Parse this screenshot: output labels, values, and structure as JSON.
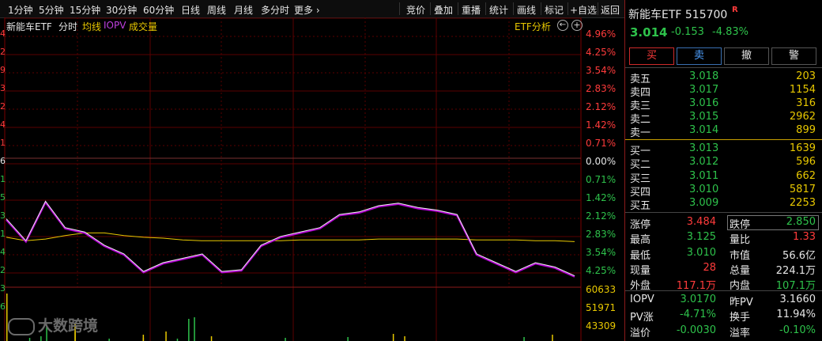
{
  "toolbar": {
    "periods": [
      "1分钟",
      "5分钟",
      "15分钟",
      "30分钟",
      "60分钟",
      "日线",
      "周线",
      "月线",
      "多分时",
      "更多 ›"
    ],
    "buttons": [
      "竞价",
      "叠加",
      "重播",
      "统计",
      "画线",
      "标记",
      "+自选",
      "返回"
    ]
  },
  "chart_header": {
    "name": "新能车ETF",
    "mode": "分时",
    "avg_label": "均线",
    "iopv_label": "IOPV",
    "volume_label": "成交量",
    "etf_analysis": "ETF分析"
  },
  "right_axis": [
    "4.96%",
    "4.25%",
    "3.54%",
    "2.83%",
    "2.12%",
    "1.42%",
    "0.71%",
    "0.00%",
    "0.71%",
    "1.42%",
    "2.12%",
    "2.83%",
    "3.54%",
    "4.25%"
  ],
  "volume_axis": [
    "60633",
    "51971",
    "43309"
  ],
  "left_axis_stubs": [
    "4",
    "2",
    "9",
    "3",
    "2",
    "4",
    "1",
    "6",
    "1",
    "5",
    "3",
    "1",
    "4",
    "2",
    "3",
    "6"
  ],
  "watermark": "大数跨境",
  "colors": {
    "red": "#ff3b3b",
    "green": "#2ec24b",
    "yellow": "#e8c800",
    "purple": "#b000d0",
    "grid": "#5a0000"
  },
  "chart_data": {
    "type": "line",
    "series": [
      {
        "name": "均线",
        "color": "#e8c800",
        "values": [
          3.05,
          3.046,
          3.048,
          3.052,
          3.055,
          3.055,
          3.052,
          3.05,
          3.049,
          3.047,
          3.046,
          3.046,
          3.046,
          3.046,
          3.046,
          3.047,
          3.047,
          3.047,
          3.047,
          3.048,
          3.048,
          3.048,
          3.048,
          3.048,
          3.047,
          3.047,
          3.047,
          3.046,
          3.046,
          3.045
        ]
      },
      {
        "name": "IOPV",
        "color": "#b000d0",
        "values": [
          3.07,
          3.045,
          3.09,
          3.06,
          3.055,
          3.04,
          3.03,
          3.01,
          3.02,
          3.025,
          3.03,
          3.01,
          3.012,
          3.04,
          3.05,
          3.055,
          3.06,
          3.075,
          3.078,
          3.085,
          3.088,
          3.083,
          3.08,
          3.075,
          3.03,
          3.02,
          3.01,
          3.02,
          3.015,
          3.005
        ]
      }
    ],
    "ylim": [
      2.993,
      3.301
    ]
  },
  "panel": {
    "title": "新能车ETF 515700",
    "title_mark": "R",
    "price": "3.014",
    "change": "-0.153",
    "change_pct": "-4.83%",
    "trade_buttons": [
      "买",
      "卖",
      "撤",
      "警"
    ],
    "asks": [
      {
        "label": "卖五",
        "price": "3.018",
        "vol": "203"
      },
      {
        "label": "卖四",
        "price": "3.017",
        "vol": "1154"
      },
      {
        "label": "卖三",
        "price": "3.016",
        "vol": "316"
      },
      {
        "label": "卖二",
        "price": "3.015",
        "vol": "2962"
      },
      {
        "label": "卖一",
        "price": "3.014",
        "vol": "899"
      }
    ],
    "bids": [
      {
        "label": "买一",
        "price": "3.013",
        "vol": "1639"
      },
      {
        "label": "买二",
        "price": "3.012",
        "vol": "596"
      },
      {
        "label": "买三",
        "price": "3.011",
        "vol": "662"
      },
      {
        "label": "买四",
        "price": "3.010",
        "vol": "5817"
      },
      {
        "label": "买五",
        "price": "3.009",
        "vol": "2253"
      }
    ],
    "stats": [
      {
        "l1": "涨停",
        "v1": "3.484",
        "c1": "red",
        "l2": "跌停",
        "v2": "2.850",
        "c2": "green"
      },
      {
        "l1": "最高",
        "v1": "3.125",
        "c1": "green",
        "l2": "量比",
        "v2": "1.33",
        "c2": "red"
      },
      {
        "l1": "最低",
        "v1": "3.010",
        "c1": "green",
        "l2": "市值",
        "v2": "56.6亿",
        "c2": "white"
      },
      {
        "l1": "现量",
        "v1": "28",
        "c1": "red",
        "l2": "总量",
        "v2": "224.1万",
        "c2": "white"
      },
      {
        "l1": "外盘",
        "v1": "117.1万",
        "c1": "red",
        "l2": "内盘",
        "v2": "107.1万",
        "c2": "green"
      }
    ],
    "iopv": [
      {
        "l1": "IOPV",
        "v1": "3.0170",
        "c1": "green",
        "l2": "昨PV",
        "v2": "3.1660",
        "c2": "white"
      },
      {
        "l1": "PV涨",
        "v1": "-4.71%",
        "c1": "green",
        "l2": "换手",
        "v2": "11.94%",
        "c2": "white"
      },
      {
        "l1": "溢价",
        "v1": "-0.0030",
        "c1": "green",
        "l2": "溢率",
        "v2": "-0.10%",
        "c2": "green"
      }
    ]
  }
}
